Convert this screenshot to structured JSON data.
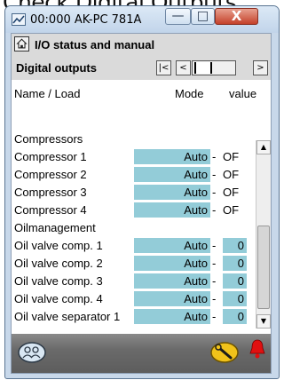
{
  "page_caption": "Check Digital Outputs",
  "window": {
    "title": "00:000 AK-PC 781A",
    "minimize_glyph": "—",
    "maximize_glyph": "□",
    "close_glyph": "X"
  },
  "header": {
    "title": "I/O status and manual"
  },
  "subheader": {
    "title": "Digital outputs",
    "nav_first": "|<",
    "nav_prev": "<",
    "nav_next": ">"
  },
  "columns": {
    "name": "Name / Load",
    "mode": "Mode",
    "value": "value"
  },
  "rows": [
    {
      "name": "Compressors",
      "type": "group"
    },
    {
      "name": "Compressor 1",
      "mode": "Auto",
      "value": "OF",
      "value_boxed": false
    },
    {
      "name": "Compressor 2",
      "mode": "Auto",
      "value": "OF",
      "value_boxed": false
    },
    {
      "name": "Compressor 3",
      "mode": "Auto",
      "value": "OF",
      "value_boxed": false
    },
    {
      "name": "Compressor 4",
      "mode": "Auto",
      "value": "OF",
      "value_boxed": false
    },
    {
      "name": "Oilmanagement",
      "type": "group"
    },
    {
      "name": "Oil valve comp. 1",
      "mode": "Auto",
      "value": "0",
      "value_boxed": true
    },
    {
      "name": "Oil valve comp. 2",
      "mode": "Auto",
      "value": "0",
      "value_boxed": true
    },
    {
      "name": "Oil valve comp. 3",
      "mode": "Auto",
      "value": "0",
      "value_boxed": true
    },
    {
      "name": "Oil valve comp. 4",
      "mode": "Auto",
      "value": "0",
      "value_boxed": true
    },
    {
      "name": "Oil valve separator 1",
      "mode": "Auto",
      "value": "0",
      "value_boxed": true
    }
  ],
  "dash": "-",
  "colors": {
    "cell_fill": "#93ccd8",
    "window_frame": "#c8d8ea",
    "alarm": "#e01010",
    "tool": "#f0c21a"
  },
  "icons": {
    "app": "chart-line-icon",
    "home": "home-icon",
    "login": "users-icon",
    "tool": "wrench-icon",
    "alarm": "bell-icon"
  }
}
